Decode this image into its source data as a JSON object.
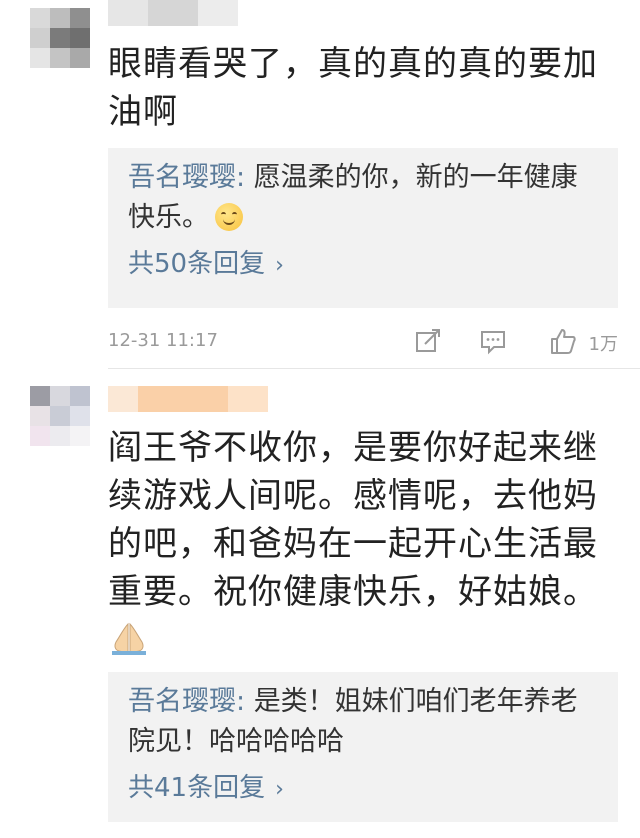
{
  "comments": [
    {
      "text": "眼睛看哭了，真的真的真的要加油啊",
      "reply": {
        "author": "吾名璎璎",
        "separator": ": ",
        "text": "愿温柔的你，新的一年健康快乐。",
        "emoji": "smiling-face",
        "more_label": "共50条回复"
      },
      "time": "12-31 11:17",
      "likes": "1万"
    },
    {
      "text": "阎王爷不收你，是要你好起来继续游戏人间呢。感情呢，去他妈的吧，和爸妈在一起开心生活最重要。祝你健康快乐，好姑娘。",
      "emoji": "folded-hands",
      "reply": {
        "author": "吾名璎璎",
        "separator": ": ",
        "text": "是类！姐妹们咱们老年养老院见！哈哈哈哈哈",
        "more_label": "共41条回复"
      }
    }
  ],
  "colors": {
    "link": "#5a7a99",
    "reply_bg": "#f2f2f2",
    "meta": "#9a9a9a"
  },
  "icons": [
    "share-icon",
    "comment-icon",
    "like-icon",
    "chevron-right-icon"
  ]
}
